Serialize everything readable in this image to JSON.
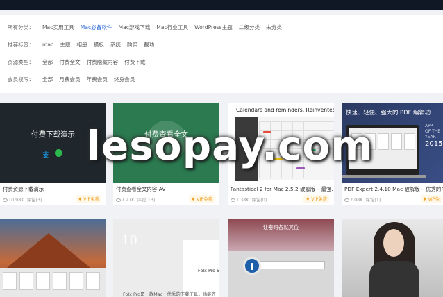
{
  "filters": [
    {
      "label": "所有分类：",
      "options": [
        "Mac实用工具",
        "Mac必备软件",
        "Mac游戏下载",
        "Mac行业工具",
        "WordPress主题",
        "二级分类",
        "未分类"
      ],
      "active": 1
    },
    {
      "label": "推荐标签：",
      "options": [
        "mac",
        "主题",
        "相册",
        "模板",
        "系统",
        "购买",
        "截功"
      ],
      "active": -1
    },
    {
      "label": "资源类型：",
      "options": [
        "全部",
        "付费全文",
        "付费隐藏内容",
        "付费下载"
      ],
      "active": -1
    },
    {
      "label": "会员权限：",
      "options": [
        "全部",
        "月费会员",
        "年费会员",
        "终身会员"
      ],
      "active": -1
    }
  ],
  "cards": [
    {
      "thumb_text": "付费下载演示",
      "title": "付费资源下载演示",
      "views": "10.98K",
      "comments": "评论(3)",
      "badge": "VIP免费"
    },
    {
      "thumb_text": "付费查看全文",
      "title": "付费查看全文内容-AV",
      "views": "7.27K",
      "comments": "评论(13)",
      "badge": "VIP免费"
    },
    {
      "thumb_text": "Calendars and reminders. Reinvented.",
      "title": "Fantastical 2 for Mac 2.5.2 破解版 – 最强…",
      "views": "1.38K",
      "comments": "评论(0)",
      "badge": "VIP免费"
    },
    {
      "thumb_text": "快速、轻便、强大的 PDF 编辑功",
      "title": "PDF Expert 2.4.10 Mac 破解版 – 优秀的P…",
      "views": "2.08K",
      "comments": "评论(1)",
      "badge": "VIP免"
    }
  ],
  "row2": {
    "card6_num": "10",
    "card6_brand": "Folx Pro 5",
    "card6_caption": "Folx Pro是一款Mac上优秀的下载工具，功能齐",
    "card7_header": "让密码各就其位"
  },
  "card4_side": {
    "line1": "APP",
    "line2": "OF THE",
    "line3": "YEAR",
    "year": "2015"
  },
  "watermark": "lesopay.com"
}
